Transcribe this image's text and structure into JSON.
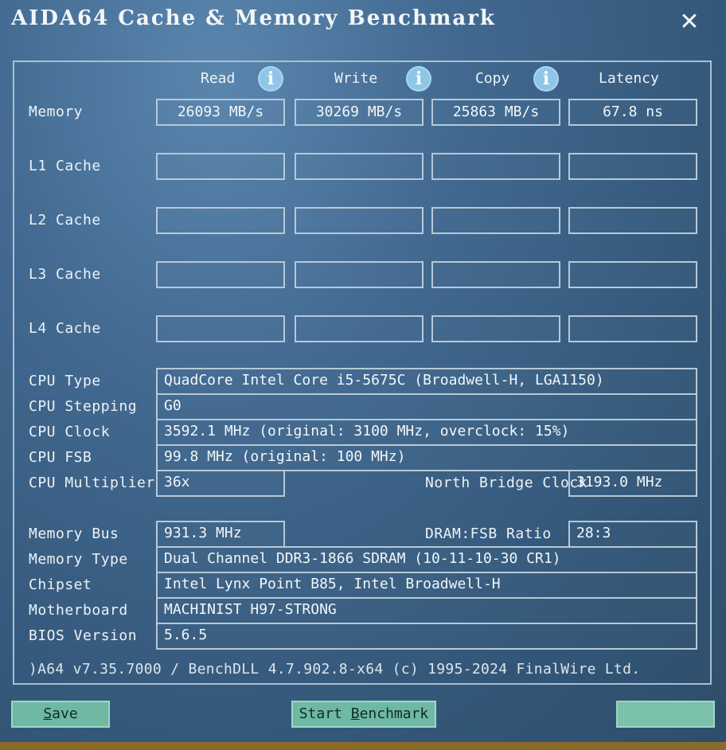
{
  "window": {
    "title": "AIDA64 Cache & Memory Benchmark",
    "close_glyph": "✕"
  },
  "columns": [
    {
      "label": "Read",
      "info": "i"
    },
    {
      "label": "Write",
      "info": "i"
    },
    {
      "label": "Copy",
      "info": "i"
    },
    {
      "label": "Latency"
    }
  ],
  "rows": [
    {
      "label": "Memory",
      "values": [
        "26093 MB/s",
        "30269 MB/s",
        "25863 MB/s",
        "67.8 ns"
      ]
    },
    {
      "label": "L1 Cache",
      "values": [
        "",
        "",
        "",
        ""
      ]
    },
    {
      "label": "L2 Cache",
      "values": [
        "",
        "",
        "",
        ""
      ]
    },
    {
      "label": "L3 Cache",
      "values": [
        "",
        "",
        "",
        ""
      ]
    },
    {
      "label": "L4 Cache",
      "values": [
        "",
        "",
        "",
        ""
      ]
    }
  ],
  "cpu": {
    "type_label": "CPU Type",
    "type_value": "QuadCore Intel Core i5-5675C  (Broadwell-H, LGA1150)",
    "stepping_label": "CPU Stepping",
    "stepping_value": "G0",
    "clock_label": "CPU Clock",
    "clock_value": "3592.1 MHz  (original: 3100 MHz, overclock: 15%)",
    "fsb_label": "CPU FSB",
    "fsb_value": "99.8 MHz  (original: 100 MHz)",
    "multiplier_label": "CPU Multiplier",
    "multiplier_value": "36x",
    "nb_clock_label": "North Bridge Clock",
    "nb_clock_value": "3193.0 MHz"
  },
  "memory": {
    "bus_label": "Memory Bus",
    "bus_value": "931.3 MHz",
    "ratio_label": "DRAM:FSB Ratio",
    "ratio_value": "28:3",
    "type_label": "Memory Type",
    "type_value": "Dual Channel DDR3-1866 SDRAM  (10-11-10-30 CR1)",
    "chipset_label": "Chipset",
    "chipset_value": "Intel Lynx Point B85, Intel Broadwell-H",
    "motherboard_label": "Motherboard",
    "motherboard_value": "MACHINIST H97-STRONG",
    "bios_label": "BIOS Version",
    "bios_value": "5.6.5"
  },
  "footer": {
    "text": ")A64 v7.35.7000 / BenchDLL 4.7.902.8-x64  (c) 1995-2024 FinalWire Ltd."
  },
  "buttons": {
    "save_first": "S",
    "save_rest": "ave",
    "start_prefix": "Start ",
    "start_underlined": "B",
    "start_rest": "enchmark"
  },
  "colors": {
    "background": "#41688f",
    "button": "#6fb9a4",
    "info_icon": "#8fc6e8"
  }
}
